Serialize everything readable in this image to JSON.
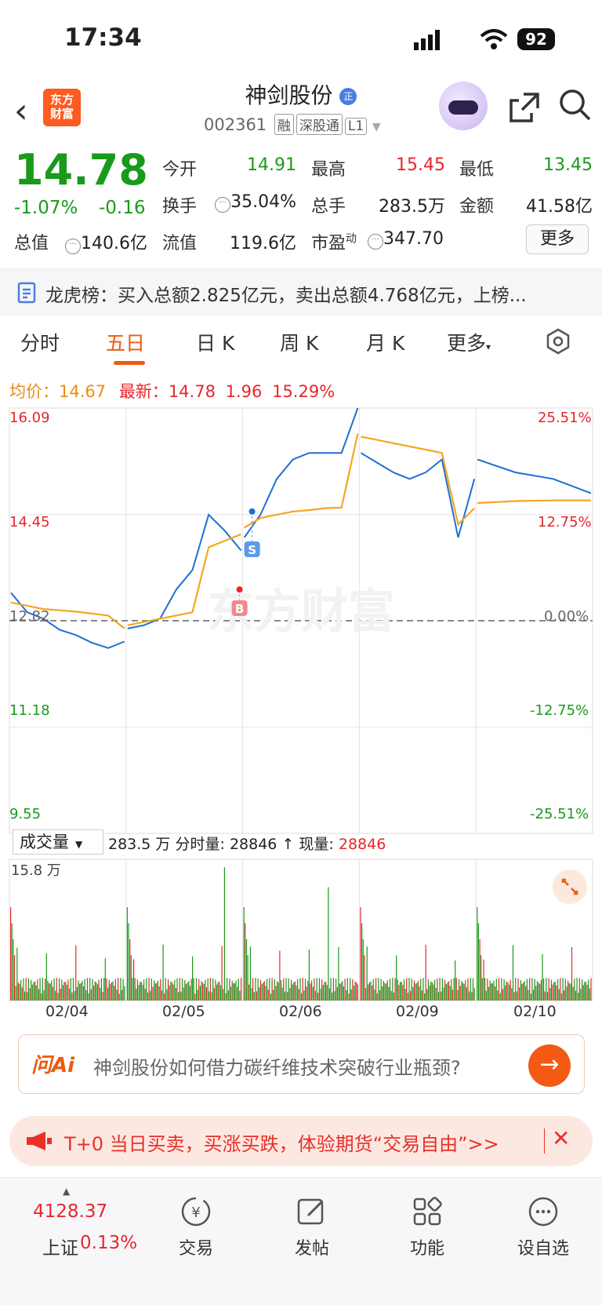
{
  "status_bar": {
    "time": "17:34",
    "battery": "92"
  },
  "header": {
    "logo_line1": "东方",
    "logo_line2": "财富",
    "stock_name": "神剑股份",
    "name_badge": "正",
    "code": "002361",
    "tags": [
      "融",
      "深股通",
      "L1"
    ]
  },
  "quote": {
    "price": "14.78",
    "change_pct": "-1.07%",
    "change": "-0.16",
    "open_label": "今开",
    "open": "14.91",
    "high_label": "最高",
    "high": "15.45",
    "low_label": "最低",
    "low": "13.45",
    "turnover_label": "换手",
    "turnover": "35.04%",
    "volume_label": "总手",
    "volume": "283.5万",
    "amount_label": "金额",
    "amount": "41.58亿",
    "mktcap_label": "总值",
    "mktcap": "140.6亿",
    "float_label": "流值",
    "float": "119.6亿",
    "pe_label": "市盈",
    "pe_sup": "动",
    "pe": "347.70",
    "more_button": "更多"
  },
  "dragon_tiger": {
    "text": "龙虎榜：买入总额2.825亿元，卖出总额4.768亿元，上榜..."
  },
  "tabs": {
    "items": [
      "分时",
      "五日",
      "日 K",
      "周 K",
      "月 K",
      "更多"
    ],
    "active": "五日"
  },
  "chart_header": {
    "avg_label": "均价：",
    "avg": "14.67",
    "latest_label": "最新：",
    "latest": "14.78",
    "latest_chg": "1.96",
    "latest_pct": "15.29%"
  },
  "chart_data": {
    "type": "line",
    "x": [
      "02/04",
      "02/05",
      "02/06",
      "02/09",
      "02/10"
    ],
    "y_left_ticks": [
      "16.09",
      "14.45",
      "12.82",
      "11.18",
      "9.55"
    ],
    "y_right_ticks": [
      "25.51%",
      "12.75%",
      "0.00%",
      "-12.75%",
      "-25.51%"
    ],
    "ylim": [
      9.55,
      16.09
    ],
    "prev_close": 12.82,
    "series": [
      {
        "name": "最新",
        "color": "#1f6fd4",
        "values": [
          13.25,
          12.95,
          12.85,
          12.68,
          12.6,
          12.48,
          12.4,
          12.5,
          12.7,
          12.75,
          12.85,
          13.3,
          13.6,
          14.45,
          14.2,
          13.9,
          14.1,
          14.45,
          15.0,
          15.3,
          15.4,
          15.4,
          15.4,
          16.09,
          15.4,
          15.25,
          15.1,
          15.0,
          15.1,
          15.3,
          14.1,
          15.0,
          15.3,
          15.1,
          15.0,
          14.78
        ]
      },
      {
        "name": "均价",
        "color": "#f5a623",
        "values": [
          13.1,
          13.05,
          13.0,
          12.98,
          12.96,
          12.93,
          12.9,
          12.7,
          12.75,
          12.8,
          12.85,
          12.9,
          12.95,
          13.95,
          14.05,
          14.15,
          14.25,
          14.4,
          14.45,
          14.5,
          14.52,
          14.55,
          14.56,
          15.7,
          15.65,
          15.6,
          15.55,
          15.5,
          15.45,
          15.4,
          14.3,
          14.55,
          14.63,
          14.66,
          14.67,
          14.67
        ]
      }
    ],
    "markers": [
      {
        "label": "B",
        "day": "02/05"
      },
      {
        "label": "S",
        "day": "02/06"
      }
    ]
  },
  "volume": {
    "selector": "成交量",
    "total": "283.5 万",
    "tick_label": "分时量:",
    "tick": "28846",
    "now_label": "现量:",
    "now": "28846",
    "max_label": "15.8 万"
  },
  "ai": {
    "logo": "问Ai",
    "question": "神剑股份如何借力碳纤维技术突破行业瓶颈?"
  },
  "promo": {
    "text": "T+0 当日买卖，买涨买跌，体验期货“交易自由”>>"
  },
  "bottom_nav": {
    "index_value": "4128.37",
    "index_name": "上证",
    "index_change": "0.13%",
    "items": [
      "交易",
      "发帖",
      "功能",
      "设自选"
    ]
  }
}
